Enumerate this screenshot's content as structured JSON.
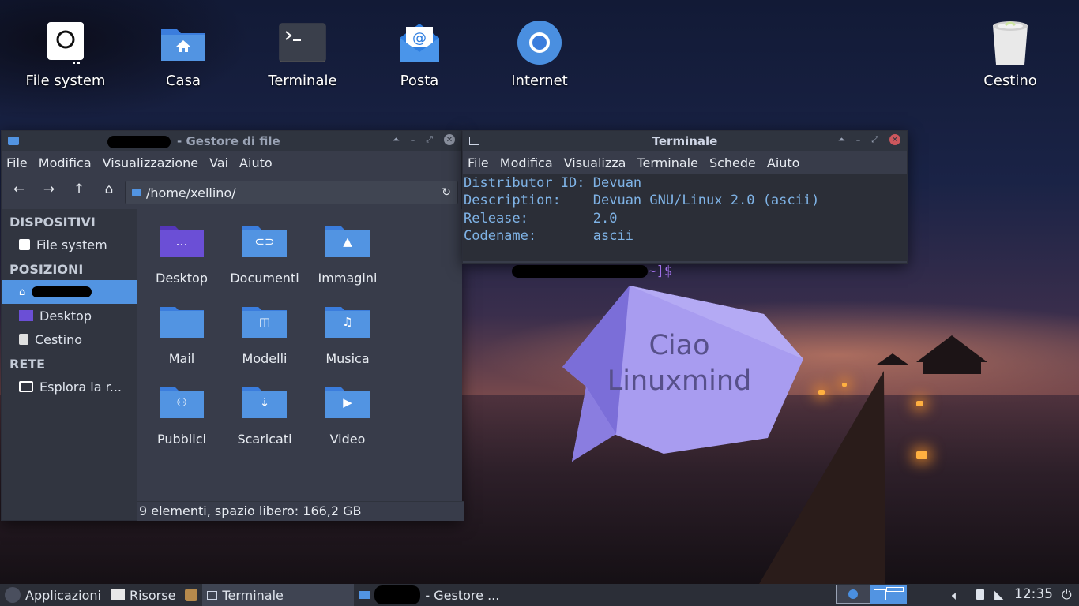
{
  "desktop": {
    "icons": [
      {
        "label": "File system",
        "icon": "drive-icon"
      },
      {
        "label": "Casa",
        "icon": "home-folder-icon"
      },
      {
        "label": "Terminale",
        "icon": "terminal-icon"
      },
      {
        "label": "Posta",
        "icon": "mail-icon"
      },
      {
        "label": "Internet",
        "icon": "browser-icon"
      },
      {
        "label": "Cestino",
        "icon": "trash-icon"
      }
    ]
  },
  "file_manager": {
    "title": "- Gestore di file",
    "menu": [
      "File",
      "Modifica",
      "Visualizzazione",
      "Vai",
      "Aiuto"
    ],
    "path": "/home/xellino/",
    "sidebar": {
      "devices_header": "DISPOSITIVI",
      "devices": [
        {
          "label": "File system"
        }
      ],
      "places_header": "POSIZIONI",
      "places": [
        {
          "label": ""
        },
        {
          "label": "Desktop"
        },
        {
          "label": "Cestino"
        }
      ],
      "network_header": "RETE",
      "network": [
        {
          "label": "Esplora la r..."
        }
      ]
    },
    "folders": [
      {
        "label": "Desktop",
        "glyph": "…",
        "color": "#6b4fd6"
      },
      {
        "label": "Documenti",
        "glyph": "⊂⊃",
        "color": "#5294e2"
      },
      {
        "label": "Immagini",
        "glyph": "▲",
        "color": "#5294e2"
      },
      {
        "label": "Mail",
        "glyph": "",
        "color": "#5294e2"
      },
      {
        "label": "Modelli",
        "glyph": "◫",
        "color": "#5294e2"
      },
      {
        "label": "Musica",
        "glyph": "♫",
        "color": "#5294e2"
      },
      {
        "label": "Pubblici",
        "glyph": "⚇",
        "color": "#5294e2"
      },
      {
        "label": "Scaricati",
        "glyph": "⇣",
        "color": "#5294e2"
      },
      {
        "label": "Video",
        "glyph": "▶",
        "color": "#5294e2"
      }
    ],
    "status": "9 elementi, spazio libero: 166,2 GB"
  },
  "terminal": {
    "title": "Terminale",
    "menu": [
      "File",
      "Modifica",
      "Visualizza",
      "Terminale",
      "Schede",
      "Aiuto"
    ],
    "lines": [
      "Distributor ID: Devuan",
      "Description:    Devuan GNU/Linux 2.0 (ascii)",
      "Release:        2.0",
      "Codename:       ascii"
    ],
    "prompt_suffix": "~]$"
  },
  "bubble": {
    "line1": "Ciao",
    "line2": "Linuxmind"
  },
  "taskbar": {
    "apps_label": "Applicazioni",
    "resources_label": "Risorse",
    "terminal_label": "Terminale",
    "filemanager_label": "- Gestore ...",
    "clock": "12:35"
  },
  "colors": {
    "accent": "#5294e2",
    "panel": "#2b2e37",
    "window": "#383c4a"
  }
}
